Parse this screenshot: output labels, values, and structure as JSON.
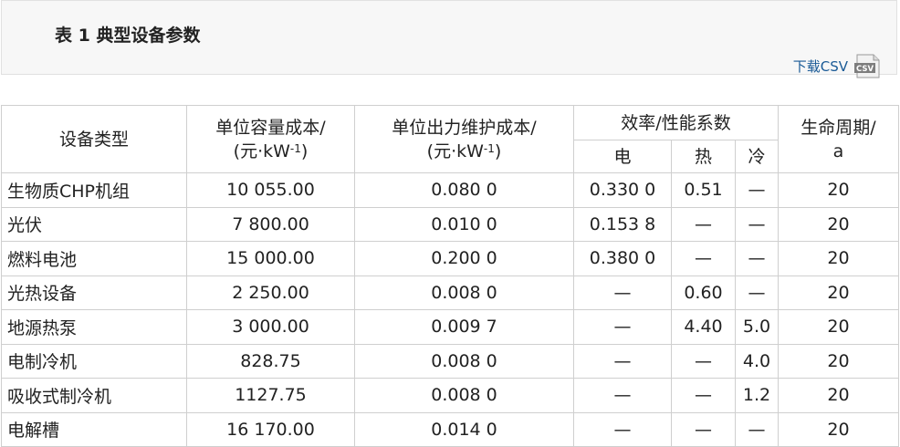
{
  "caption": {
    "title": "表 1 典型设备参数",
    "csv_label": "下载CSV",
    "csv_icon_text": "CSV"
  },
  "table": {
    "headers": {
      "device_type": "设备类型",
      "capacity_cost": "单位容量成本/",
      "capacity_cost_unit": "(元·kW",
      "maintenance_cost": "单位出力维护成本/",
      "maintenance_cost_unit": "(元·kW",
      "unit_exponent": "-1",
      "unit_close": ")",
      "efficiency": "效率/性能系数",
      "efficiency_elec": "电",
      "efficiency_heat": "热",
      "efficiency_cold": "冷",
      "lifetime": "生命周期/",
      "lifetime_unit": "a"
    },
    "rows": [
      [
        "生物质CHP机组",
        "10 055.00",
        "0.080 0",
        "0.330 0",
        "0.51",
        "—",
        "20"
      ],
      [
        "光伏",
        "7 800.00",
        "0.010 0",
        "0.153 8",
        "—",
        "—",
        "20"
      ],
      [
        "燃料电池",
        "15 000.00",
        "0.200 0",
        "0.380 0",
        "—",
        "—",
        "20"
      ],
      [
        "光热设备",
        "2 250.00",
        "0.008 0",
        "—",
        "0.60",
        "—",
        "20"
      ],
      [
        "地源热泵",
        "3 000.00",
        "0.009 7",
        "—",
        "4.40",
        "5.0",
        "20"
      ],
      [
        "电制冷机",
        "828.75",
        "0.008 0",
        "—",
        "—",
        "4.0",
        "20"
      ],
      [
        "吸收式制冷机",
        "1127.75",
        "0.008 0",
        "—",
        "—",
        "1.2",
        "20"
      ],
      [
        "电解槽",
        "16 170.00",
        "0.014 0",
        "—",
        "—",
        "—",
        "20"
      ]
    ]
  }
}
